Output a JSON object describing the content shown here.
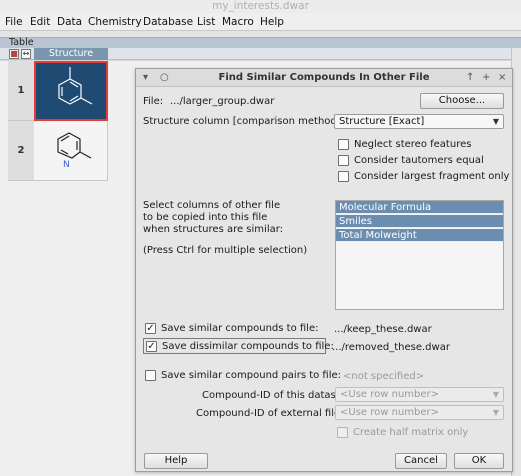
{
  "window": {
    "title": "my_interests.dwar"
  },
  "menu": [
    "File",
    "Edit",
    "Data",
    "Chemistry",
    "Database",
    "List",
    "Macro",
    "Help"
  ],
  "table_tab": "Table",
  "grid": {
    "column_header": "Structure",
    "rows": [
      {
        "number": "1",
        "structure": "m-xylene",
        "selected": true
      },
      {
        "number": "2",
        "structure": "2-methylpyridine",
        "selected": false,
        "atom_label": "N"
      }
    ]
  },
  "dialog": {
    "title": "Find Similar Compounds In Other File",
    "file_label": "File:",
    "file_value": ".../larger_group.dwar",
    "choose_button": "Choose...",
    "structure_column_label": "Structure column [comparison method]:",
    "structure_column_value": "Structure [Exact]",
    "options": [
      {
        "label": "Neglect stereo features",
        "checked": false
      },
      {
        "label": "Consider tautomers equal",
        "checked": false
      },
      {
        "label": "Consider largest fragment only",
        "checked": false
      }
    ],
    "copy_instructions": [
      "Select columns of other file",
      "to be copied into this file",
      "when structures are similar:",
      "",
      "(Press Ctrl for multiple selection)"
    ],
    "columns": [
      "Molecular Formula",
      "Smiles",
      "Total Molweight"
    ],
    "save_similar": {
      "label": "Save similar compounds to file:",
      "checked": true,
      "path": ".../keep_these.dwar"
    },
    "save_dissimilar": {
      "label": "Save dissimilar compounds to file:",
      "checked": true,
      "path": ".../removed_these.dwar"
    },
    "save_pairs": {
      "label": "Save similar compound pairs to file:",
      "checked": false,
      "path": "<not specified>"
    },
    "id_this_label": "Compound-ID of this dataset:",
    "id_this_value": "<Use row number>",
    "id_external_label": "Compound-ID of external file:",
    "id_external_value": "<Use row number>",
    "half_matrix": {
      "label": "Create half matrix only",
      "checked": false
    },
    "help_button": "Help",
    "cancel_button": "Cancel",
    "ok_button": "OK"
  }
}
